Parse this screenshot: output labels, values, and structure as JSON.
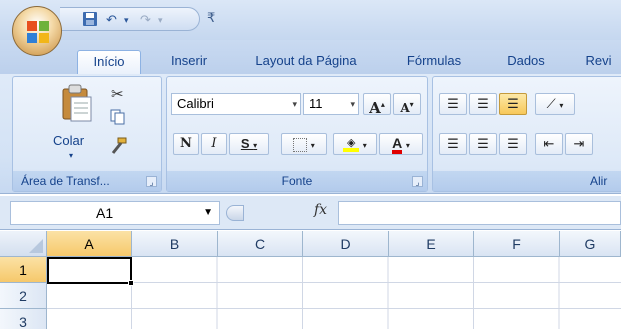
{
  "tabs": [
    {
      "label": "Início",
      "active": true
    },
    {
      "label": "Inserir"
    },
    {
      "label": "Layout da Página"
    },
    {
      "label": "Fórmulas"
    },
    {
      "label": "Dados"
    },
    {
      "label": "Revi"
    }
  ],
  "groups": {
    "clipboard": {
      "label": "Área de Transf...",
      "paste_label": "Colar"
    },
    "font": {
      "label": "Fonte",
      "font_name": "Calibri",
      "font_size": "11",
      "bold": "N",
      "italic": "I",
      "underline": "S",
      "font_color_glyph": "A",
      "grow": "A",
      "shrink": "A"
    },
    "alignment": {
      "label": "Alir"
    }
  },
  "formula_bar": {
    "name_box": "A1",
    "fx_label": "fx",
    "formula": ""
  },
  "grid": {
    "columns": [
      "A",
      "B",
      "C",
      "D",
      "E",
      "F",
      "G"
    ],
    "rows": [
      "1",
      "2",
      "3"
    ],
    "selected_cell": "A1"
  },
  "colors": {
    "ribbon": "#dfeaf8",
    "selection": "#f6c86b",
    "text": "#15428b"
  }
}
